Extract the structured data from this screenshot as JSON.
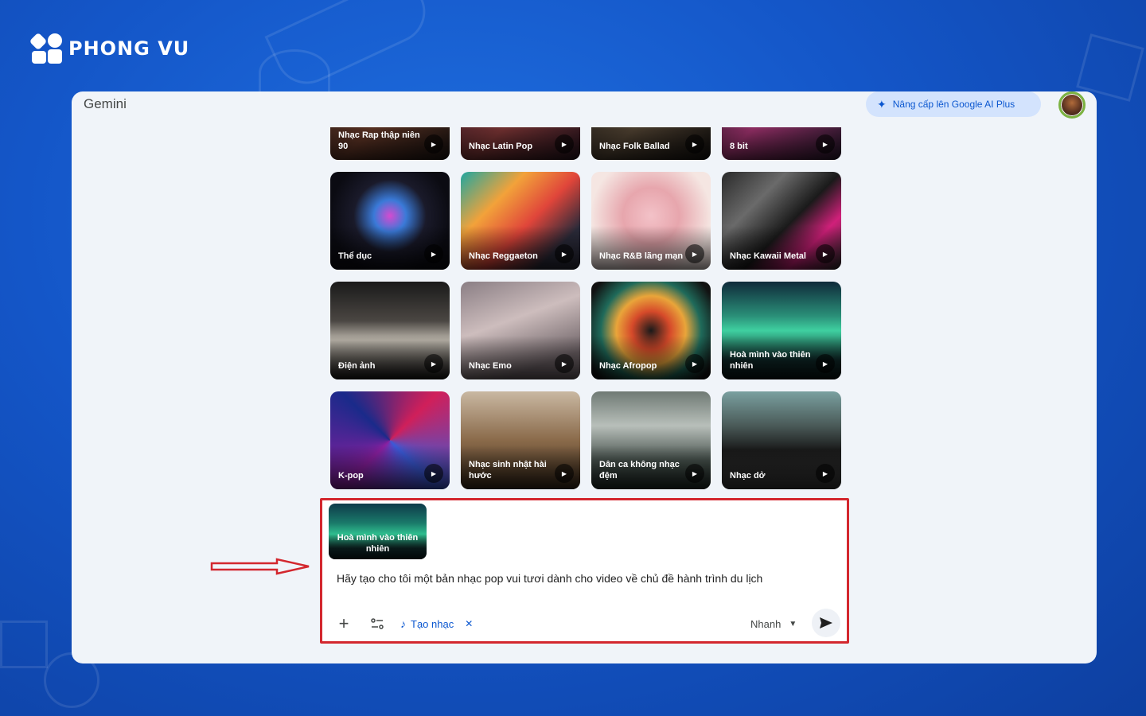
{
  "brand": {
    "name": "PHONG VU"
  },
  "app": {
    "title": "Gemini",
    "upgrade_label": "Nâng cấp lên Google AI Plus",
    "upgrade_icon": "sparkle-icon",
    "avatar_icon": "user-avatar"
  },
  "gallery": {
    "cards": [
      {
        "label": "Nhạc Rap thập niên 90",
        "name": "card-rap-90s"
      },
      {
        "label": "Nhạc Latin Pop",
        "name": "card-latin-pop"
      },
      {
        "label": "Nhạc Folk Ballad",
        "name": "card-folk-ballad"
      },
      {
        "label": "8 bit",
        "name": "card-8-bit"
      },
      {
        "label": "Thể dục",
        "name": "card-the-duc"
      },
      {
        "label": "Nhạc Reggaeton",
        "name": "card-reggaeton"
      },
      {
        "label": "Nhạc R&B lãng mạn",
        "name": "card-rnb"
      },
      {
        "label": "Nhạc Kawaii Metal",
        "name": "card-kawaii-metal"
      },
      {
        "label": "Điện ảnh",
        "name": "card-dien-anh"
      },
      {
        "label": "Nhạc Emo",
        "name": "card-emo"
      },
      {
        "label": "Nhạc Afropop",
        "name": "card-afropop"
      },
      {
        "label": "Hoà mình vào thiên nhiên",
        "name": "card-nature"
      },
      {
        "label": "K-pop",
        "name": "card-kpop"
      },
      {
        "label": "Nhạc sinh nhật hài hước",
        "name": "card-birthday"
      },
      {
        "label": "Dân ca không nhạc đệm",
        "name": "card-folk-acapella"
      },
      {
        "label": "Nhạc dở",
        "name": "card-bad-music"
      }
    ]
  },
  "composer": {
    "attached_chip": "Hoà mình vào thiên nhiên",
    "prompt": "Hãy tạo cho tôi một bản nhạc pop vui tươi dành cho video về chủ đề hành trình du lịch",
    "tool_chip_label": "Tạo nhạc",
    "mode_label": "Nhanh"
  },
  "colors": {
    "accent": "#0b57d0",
    "highlight": "#d3272e"
  }
}
